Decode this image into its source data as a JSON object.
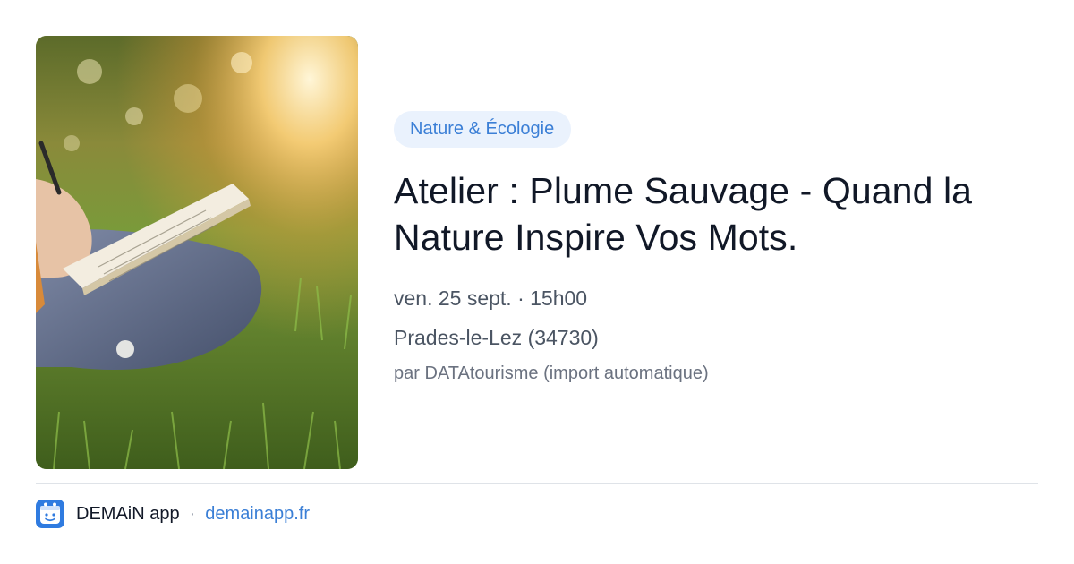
{
  "event": {
    "category": "Nature & Écologie",
    "title": "Atelier : Plume Sauvage - Quand la Nature Inspire Vos Mots.",
    "datetime": "ven. 25 sept. · 15h00",
    "location": "Prades-le-Lez (34730)",
    "source": "par DATAtourisme (import automatique)"
  },
  "footer": {
    "app_name": "DEMAiN app",
    "separator": "·",
    "domain": "demainapp.fr",
    "logo_icon": "demain-logo-icon"
  },
  "colors": {
    "accent": "#3b7fd6",
    "badge_bg": "#eaf2fd",
    "title": "#111827",
    "meta": "#4b5563"
  }
}
